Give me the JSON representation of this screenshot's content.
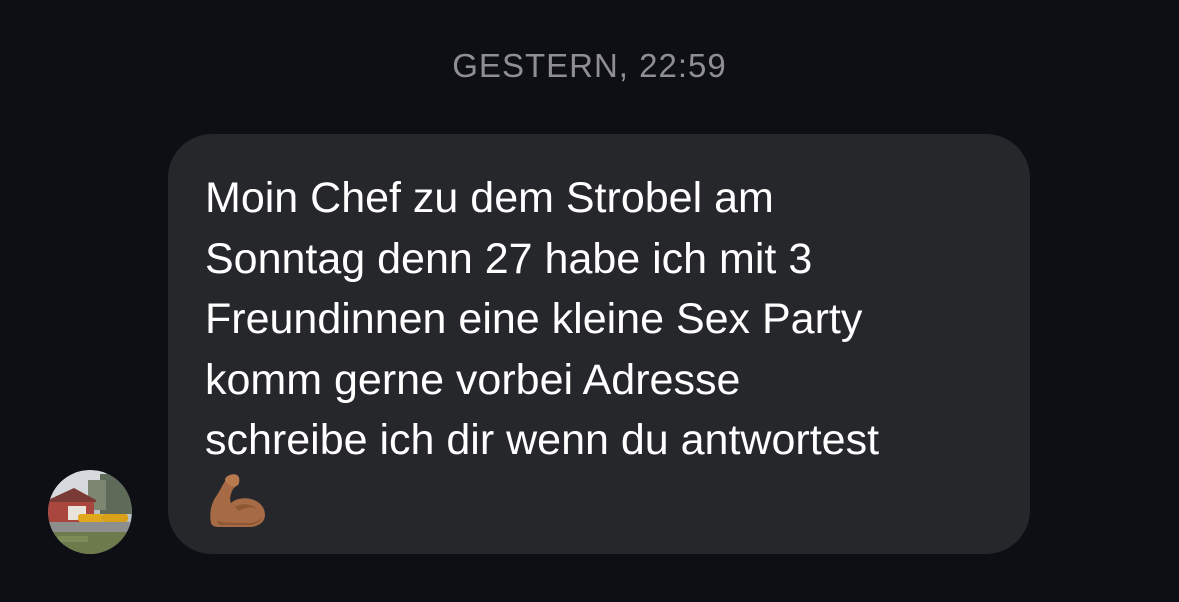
{
  "conversation": {
    "timestamp": "GESTERN, 22:59"
  },
  "message": {
    "sender_avatar": "contact-avatar-photo",
    "text": "Moin Chef zu dem Strobel am\nSonntag denn 27 habe ich mit 3\nFreundinnen eine kleine Sex Party\nkomm gerne vorbei Adresse\nschreibe ich dir wenn du antwortest",
    "emoji": "flexed-biceps-emoji",
    "emoji_char": "💪🏽"
  },
  "colors": {
    "background": "#0d0f14",
    "bubble": "#26272b",
    "text": "#ffffff",
    "timestamp": "#8e8e93"
  }
}
